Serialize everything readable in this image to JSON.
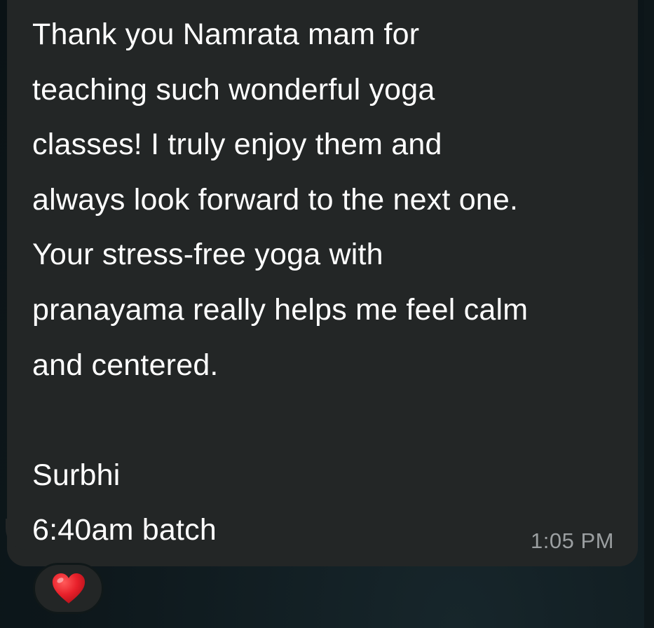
{
  "message": {
    "text": "Thank you Namrata mam for\nteaching such wonderful yoga\nclasses! I truly enjoy them and\nalways look forward to the next one.\nYour stress-free yoga with\npranayama really helps me feel calm\nand centered.\n\nSurbhi\n6:40am batch",
    "time": "1:05 PM",
    "bubble_color": "#232626",
    "text_color": "#ffffff",
    "time_color": "#9b9fa1"
  },
  "reaction": {
    "icon": "red-heart-icon",
    "color": "#e8202a"
  },
  "background_color": "#0c1519"
}
